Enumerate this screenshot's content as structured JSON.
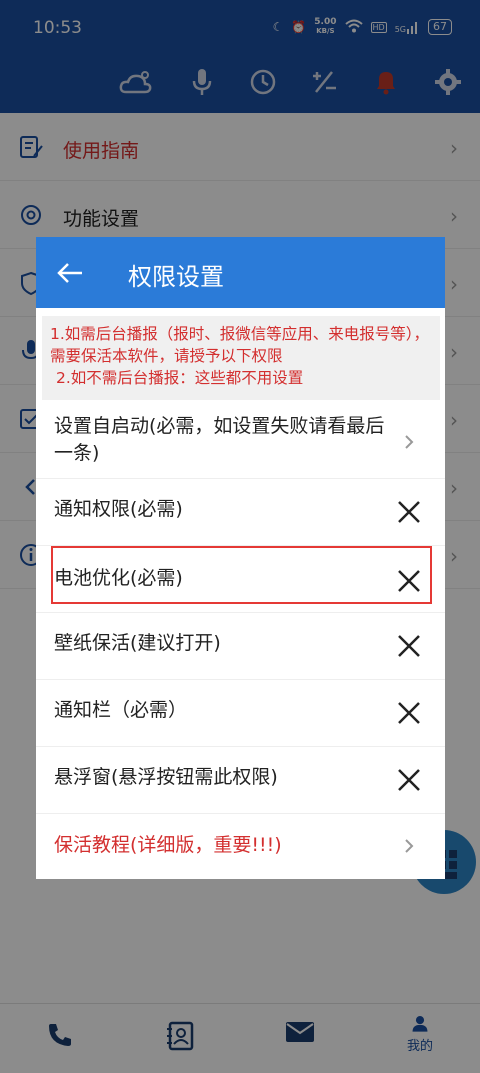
{
  "status_bar": {
    "time": "10:53",
    "net_speed_value": "5.00",
    "net_speed_unit": "KB/S",
    "hd_badge": "HD",
    "signal_label": "5G",
    "battery": "67"
  },
  "menu": {
    "items": [
      {
        "label": "使用指南",
        "icon": "guide-icon",
        "color": "#d32f2f"
      },
      {
        "label": "功能设置",
        "icon": "gear-icon"
      }
    ]
  },
  "bottom_nav": {
    "mine_label": "我的"
  },
  "dialog": {
    "title": "权限设置",
    "notice": [
      "1.如需后台播报（报时、报微信等应用、来电报号等），需要保活本软件，请授予以下权限",
      "2.如不需后台播报：这些都不用设置"
    ],
    "rows": [
      {
        "label": "设置自启动(必需，如设置失败请看最后一条)",
        "action": "chevron-right-icon"
      },
      {
        "label": "通知权限(必需)",
        "action": "close-icon"
      },
      {
        "label": "电池优化(必需)",
        "action": "close-icon",
        "highlighted": true
      },
      {
        "label": "壁纸保活(建议打开)",
        "action": "close-icon"
      },
      {
        "label": "通知栏（必需）",
        "action": "close-icon"
      },
      {
        "label": "悬浮窗(悬浮按钮需此权限)",
        "action": "close-icon"
      },
      {
        "label": "保活教程(详细版，重要!!!)",
        "action": "chevron-right-icon",
        "color": "#d32f2f"
      }
    ]
  },
  "colors": {
    "app_bar": "#1a4fa0",
    "dialog_header": "#2b7bd8",
    "warning_red": "#d32f2f",
    "highlight_border": "#e53935"
  }
}
